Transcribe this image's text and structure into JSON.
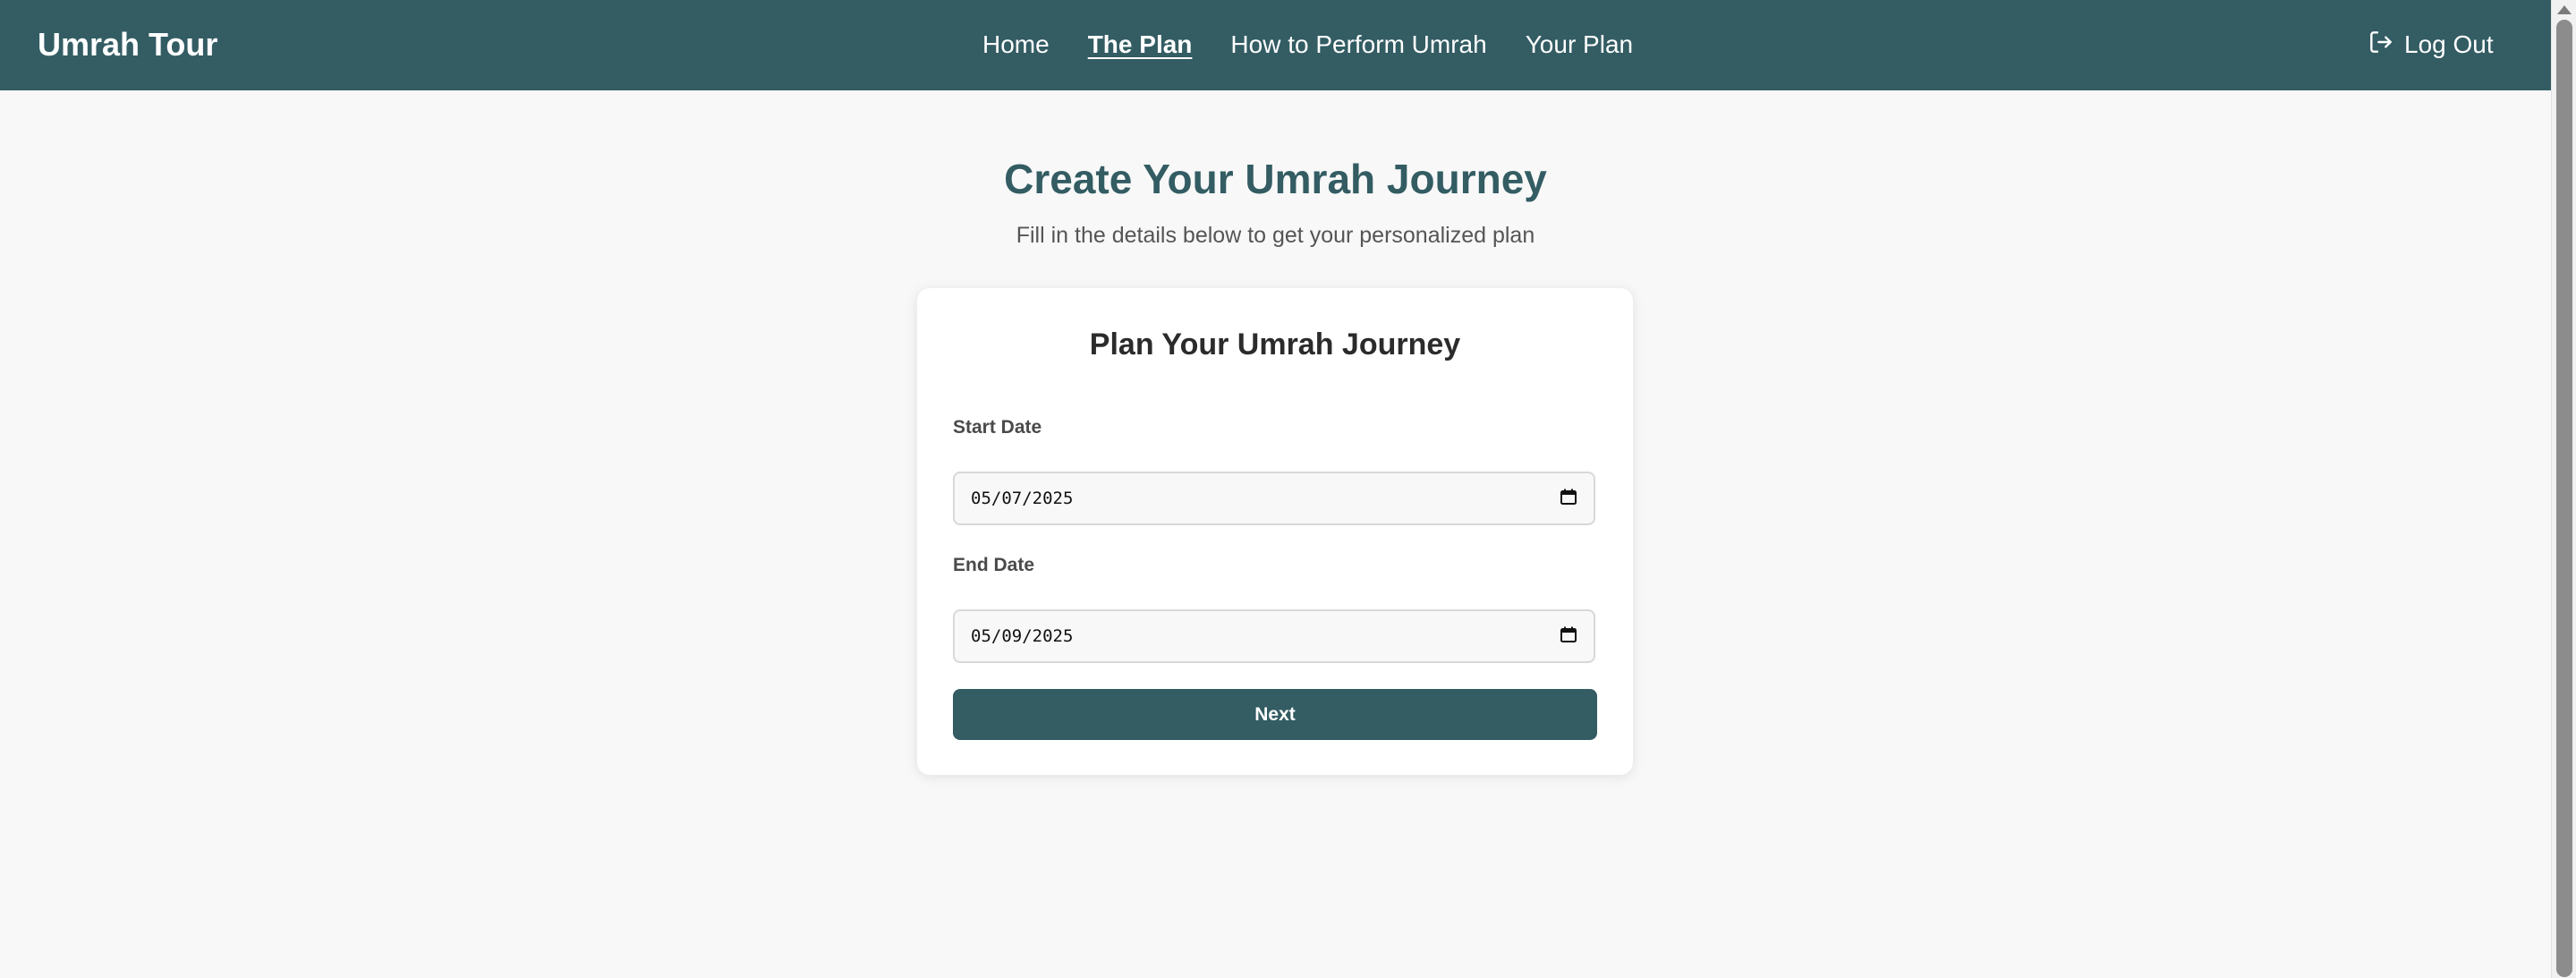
{
  "app": {
    "brand": "Umrah Tour"
  },
  "nav": {
    "items": [
      {
        "label": "Home",
        "active": false
      },
      {
        "label": "The Plan",
        "active": true
      },
      {
        "label": "How to Perform Umrah",
        "active": false
      },
      {
        "label": "Your Plan",
        "active": false
      }
    ],
    "logout_label": "Log Out",
    "logout_icon": "logout-icon"
  },
  "hero": {
    "title": "Create Your Umrah Journey",
    "subtitle": "Fill in the details below to get your personalized plan"
  },
  "form": {
    "title": "Plan Your Umrah Journey",
    "start_date": {
      "label": "Start Date",
      "value": "05/07/2025",
      "icon": "calendar-icon"
    },
    "end_date": {
      "label": "End Date",
      "value": "05/09/2025",
      "icon": "calendar-icon"
    },
    "next_label": "Next"
  },
  "colors": {
    "primary": "#335c63",
    "background": "#f8f8f8",
    "card": "#ffffff"
  }
}
